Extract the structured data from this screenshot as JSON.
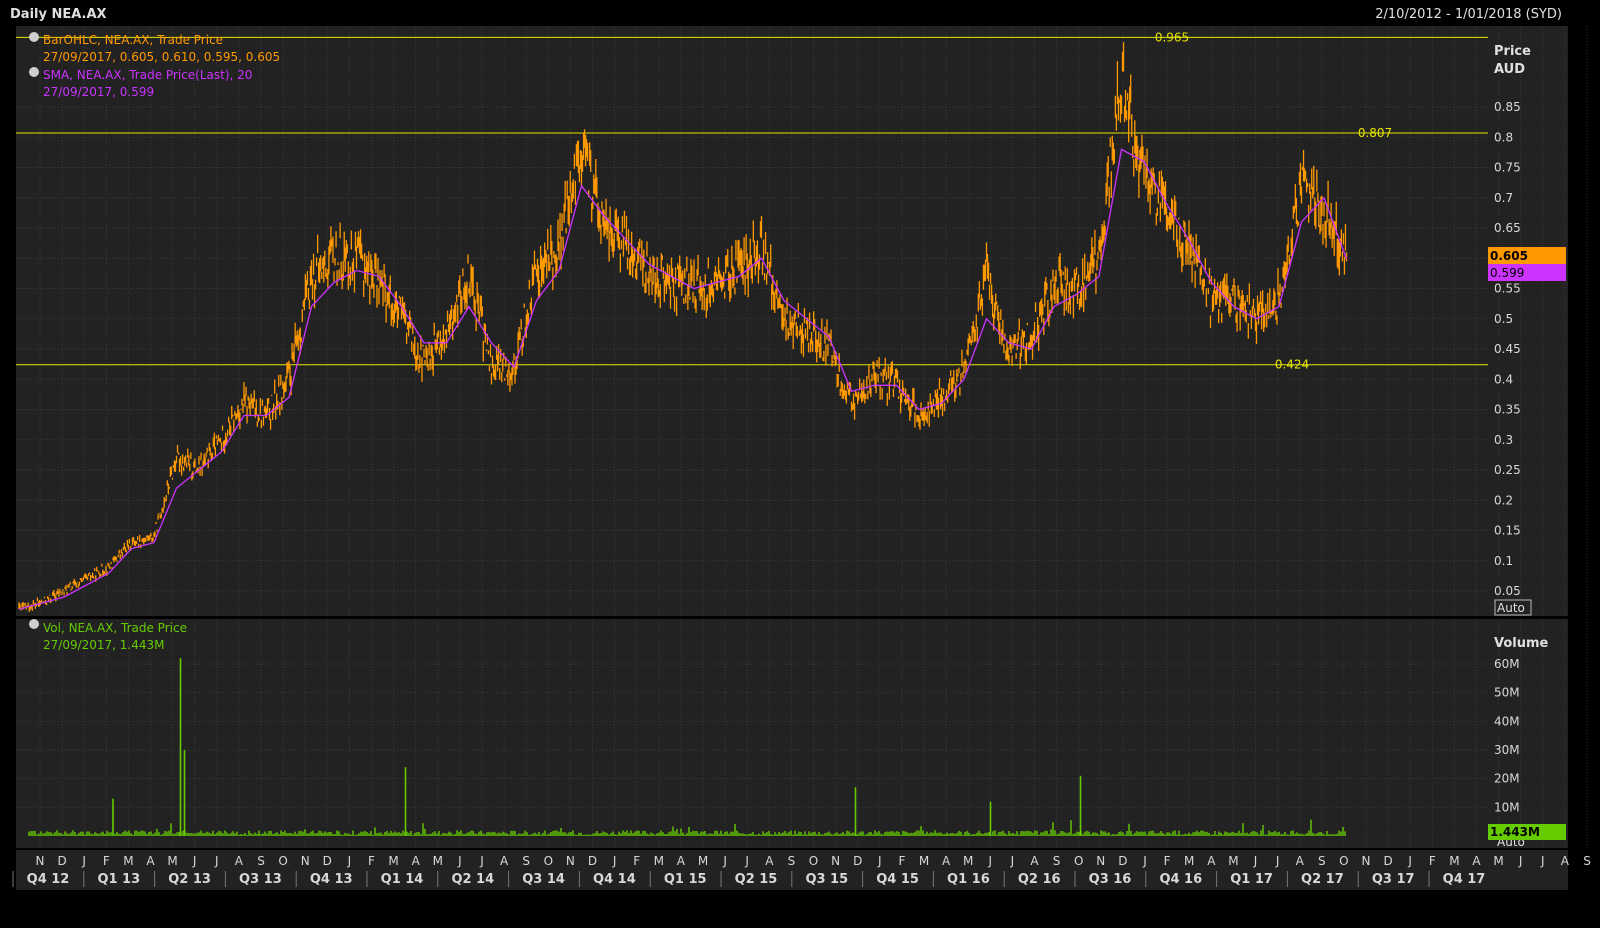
{
  "window": {
    "title": "Daily NEA.AX",
    "date_range": "2/10/2012 - 1/01/2018 (SYD)"
  },
  "colors": {
    "background": "#222222",
    "grid": "#3a3a3a",
    "price": "#ff9900",
    "sma": "#cc33ff",
    "volume": "#66cc00",
    "hline": "#e6e600",
    "text": "#d8d8d8"
  },
  "price_panel": {
    "legend": [
      {
        "icon": "globe-icon",
        "line1": "BarOHLC, NEA.AX, Trade Price",
        "line2": "27/09/2017, 0.605, 0.610, 0.595, 0.605",
        "color": "#ff9900"
      },
      {
        "icon": "globe-icon",
        "line1": "SMA, NEA.AX, Trade Price(Last),  20",
        "line2": "27/09/2017, 0.599",
        "color": "#cc33ff"
      }
    ],
    "axis_title": "Price",
    "axis_unit": "AUD",
    "auto_label": "Auto",
    "last_price": "0.605",
    "last_sma": "0.599",
    "hline_labels": [
      "0.965",
      "0.807",
      "0.424"
    ]
  },
  "volume_panel": {
    "legend": {
      "icon": "globe-icon",
      "line1": "Vol, NEA.AX, Trade Price",
      "line2": "27/09/2017, 1.443M",
      "color": "#66cc00"
    },
    "axis_title": "Volume",
    "auto_label": "Auto",
    "last_volume": "1.443M"
  },
  "chart_data": [
    {
      "type": "line",
      "title": "Daily NEA.AX",
      "ylabel": "Price AUD",
      "ylim": [
        0.0,
        1.0
      ],
      "yticks": [
        0.05,
        0.1,
        0.15,
        0.2,
        0.25,
        0.3,
        0.35,
        0.4,
        0.45,
        0.5,
        0.55,
        0.6,
        0.65,
        0.7,
        0.75,
        0.8,
        0.85
      ],
      "ytick_labels": [
        "0.05",
        "0.1",
        "0.15",
        "0.2",
        "0.25",
        "0.3",
        "0.35",
        "0.4",
        "0.45",
        "0.5",
        "0.55",
        "0.6",
        "0.65",
        "0.7",
        "0.75",
        "0.8",
        "0.85"
      ],
      "hlines": [
        0.965,
        0.807,
        0.424
      ],
      "x_months": [
        "N",
        "D",
        "J",
        "F",
        "M",
        "A",
        "M",
        "J",
        "J",
        "A",
        "S",
        "O",
        "N",
        "D",
        "J",
        "F",
        "M",
        "A",
        "M",
        "J",
        "J",
        "A",
        "S",
        "O",
        "N",
        "D",
        "J",
        "F",
        "M",
        "A",
        "M",
        "J",
        "J",
        "A",
        "S",
        "O",
        "N",
        "D",
        "J",
        "F",
        "M",
        "A",
        "M",
        "J",
        "J",
        "A",
        "S",
        "O",
        "N",
        "D",
        "J",
        "F",
        "M",
        "A",
        "M",
        "J",
        "J",
        "A",
        "S",
        "O",
        "N",
        "D",
        "J",
        "F",
        "M",
        "A",
        "M",
        "J",
        "J",
        "A",
        "S",
        "O",
        "N",
        "D",
        "J"
      ],
      "x_quarters": [
        "Q4 12",
        "Q1 13",
        "Q2 13",
        "Q3 13",
        "Q4 13",
        "Q1 14",
        "Q2 14",
        "Q3 14",
        "Q4 14",
        "Q1 15",
        "Q2 15",
        "Q3 15",
        "Q4 15",
        "Q1 16",
        "Q2 16",
        "Q3 16",
        "Q4 16",
        "Q1 17",
        "Q2 17",
        "Q3 17",
        "Q4 17"
      ],
      "series": [
        {
          "name": "BarOHLC, NEA.AX, Trade Price",
          "color": "#ff9900",
          "x": [
            "2012-10",
            "2012-11",
            "2012-12",
            "2013-01",
            "2013-02",
            "2013-03",
            "2013-04",
            "2013-05",
            "2013-06",
            "2013-07",
            "2013-08",
            "2013-09",
            "2013-10",
            "2013-11",
            "2013-12",
            "2014-01",
            "2014-02",
            "2014-03",
            "2014-04",
            "2014-05",
            "2014-06",
            "2014-07",
            "2014-08",
            "2014-09",
            "2014-10",
            "2014-11",
            "2014-12",
            "2015-01",
            "2015-02",
            "2015-03",
            "2015-04",
            "2015-05",
            "2015-06",
            "2015-07",
            "2015-08",
            "2015-09",
            "2015-10",
            "2015-11",
            "2015-12",
            "2016-01",
            "2016-02",
            "2016-03",
            "2016-04",
            "2016-05",
            "2016-06",
            "2016-07",
            "2016-08",
            "2016-09",
            "2016-10",
            "2016-11",
            "2016-12",
            "2017-01",
            "2017-02",
            "2017-03",
            "2017-04",
            "2017-05",
            "2017-06",
            "2017-07",
            "2017-08",
            "2017-09"
          ],
          "values": [
            0.02,
            0.03,
            0.05,
            0.07,
            0.09,
            0.13,
            0.14,
            0.27,
            0.25,
            0.3,
            0.36,
            0.34,
            0.4,
            0.57,
            0.6,
            0.6,
            0.56,
            0.5,
            0.43,
            0.47,
            0.58,
            0.42,
            0.42,
            0.58,
            0.62,
            0.78,
            0.65,
            0.62,
            0.58,
            0.56,
            0.55,
            0.56,
            0.58,
            0.62,
            0.5,
            0.48,
            0.45,
            0.36,
            0.4,
            0.39,
            0.34,
            0.37,
            0.42,
            0.57,
            0.44,
            0.47,
            0.55,
            0.55,
            0.6,
            0.9,
            0.73,
            0.68,
            0.62,
            0.53,
            0.53,
            0.5,
            0.53,
            0.72,
            0.68,
            0.605
          ]
        },
        {
          "name": "SMA, NEA.AX, Trade Price(Last),  20",
          "color": "#cc33ff",
          "x": [
            "2012-10",
            "2012-11",
            "2012-12",
            "2013-01",
            "2013-02",
            "2013-03",
            "2013-04",
            "2013-05",
            "2013-06",
            "2013-07",
            "2013-08",
            "2013-09",
            "2013-10",
            "2013-11",
            "2013-12",
            "2014-01",
            "2014-02",
            "2014-03",
            "2014-04",
            "2014-05",
            "2014-06",
            "2014-07",
            "2014-08",
            "2014-09",
            "2014-10",
            "2014-11",
            "2014-12",
            "2015-01",
            "2015-02",
            "2015-03",
            "2015-04",
            "2015-05",
            "2015-06",
            "2015-07",
            "2015-08",
            "2015-09",
            "2015-10",
            "2015-11",
            "2015-12",
            "2016-01",
            "2016-02",
            "2016-03",
            "2016-04",
            "2016-05",
            "2016-06",
            "2016-07",
            "2016-08",
            "2016-09",
            "2016-10",
            "2016-11",
            "2016-12",
            "2017-01",
            "2017-02",
            "2017-03",
            "2017-04",
            "2017-05",
            "2017-06",
            "2017-07",
            "2017-08",
            "2017-09"
          ],
          "values": [
            0.02,
            0.03,
            0.04,
            0.06,
            0.08,
            0.12,
            0.13,
            0.22,
            0.25,
            0.28,
            0.34,
            0.34,
            0.37,
            0.52,
            0.56,
            0.58,
            0.57,
            0.52,
            0.46,
            0.46,
            0.52,
            0.46,
            0.42,
            0.53,
            0.58,
            0.72,
            0.67,
            0.63,
            0.59,
            0.57,
            0.55,
            0.56,
            0.57,
            0.6,
            0.53,
            0.5,
            0.47,
            0.38,
            0.39,
            0.39,
            0.35,
            0.36,
            0.4,
            0.5,
            0.46,
            0.45,
            0.52,
            0.54,
            0.57,
            0.78,
            0.76,
            0.69,
            0.63,
            0.56,
            0.52,
            0.5,
            0.52,
            0.66,
            0.7,
            0.599
          ]
        }
      ]
    },
    {
      "type": "bar",
      "title": "Vol, NEA.AX, Trade Price",
      "ylabel": "Volume",
      "ylim": [
        0,
        65000000
      ],
      "yticks": [
        10000000,
        20000000,
        30000000,
        40000000,
        50000000,
        60000000
      ],
      "ytick_labels": [
        "10M",
        "20M",
        "30M",
        "40M",
        "50M",
        "60M"
      ],
      "series": [
        {
          "name": "Vol, NEA.AX, Trade Price",
          "color": "#66cc00",
          "spike_dates": [
            "2013-02",
            "2013-05",
            "2013-05",
            "2014-03",
            "2016-09",
            "2015-11",
            "2016-05"
          ],
          "spike_values": [
            13000000,
            62000000,
            30000000,
            24000000,
            21000000,
            17000000,
            12000000
          ],
          "last_value": 1443000
        }
      ]
    }
  ]
}
